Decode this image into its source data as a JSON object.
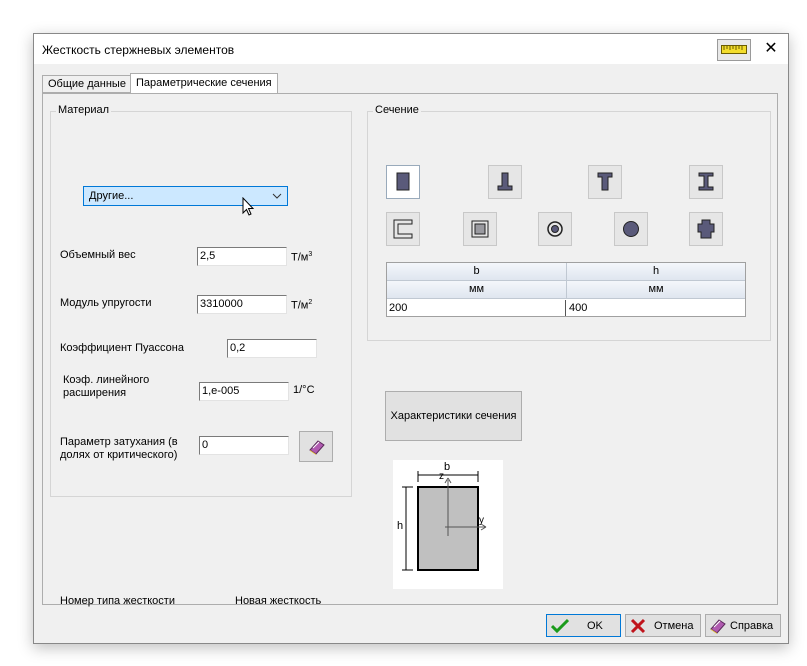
{
  "window": {
    "title": "Жесткость стержневых элементов",
    "close_glyph": "✕"
  },
  "tabs": [
    {
      "label": "Общие данные"
    },
    {
      "label": "Параметрические сечения"
    }
  ],
  "material": {
    "group_label": "Материал",
    "combo_value": "Другие...",
    "volumetric_weight": {
      "label": "Объемный вес",
      "value": "2,5",
      "unit": "Т/м",
      "unit_sup": "3"
    },
    "elastic_modulus": {
      "label": "Модуль упругости",
      "value": "3310000",
      "unit": "Т/м",
      "unit_sup": "2"
    },
    "poisson": {
      "label": "Коэффициент Пуассона",
      "value": "0,2"
    },
    "thermal": {
      "label_line1": "Коэф. линейного",
      "label_line2": "расширения",
      "value": "1,e-005",
      "unit": "1/°C"
    },
    "damping": {
      "label_line1": "Параметр затухания (в",
      "label_line2": "долях от критического)",
      "value": "0"
    }
  },
  "section": {
    "group_label": "Сечение",
    "shapes": [
      "rectangle-section-icon",
      "t-inverted-section-icon",
      "t-section-icon",
      "i-beam-section-icon",
      "channel-section-icon",
      "box-section-icon",
      "pipe-section-icon",
      "round-section-icon",
      "cross-section-icon"
    ],
    "table": {
      "headers": [
        "b",
        "h"
      ],
      "units": [
        "мм",
        "мм"
      ],
      "values": [
        "200",
        "400"
      ]
    },
    "characteristics_button": "Характеристики сечения",
    "diagram": {
      "b_label": "b",
      "h_label": "h",
      "z_label": "z",
      "y_label": "y"
    }
  },
  "stiffness": {
    "type_label": "Номер типа жесткости",
    "type_value": "Новая жесткость"
  },
  "footer": {
    "ok": "OK",
    "cancel": "Отмена",
    "help": "Справка"
  },
  "colors": {
    "accent": "#0078d7",
    "combo_bg": "#cce8ff",
    "shape_fill": "#5a5a7a",
    "ruler": "#f3dd2c"
  }
}
